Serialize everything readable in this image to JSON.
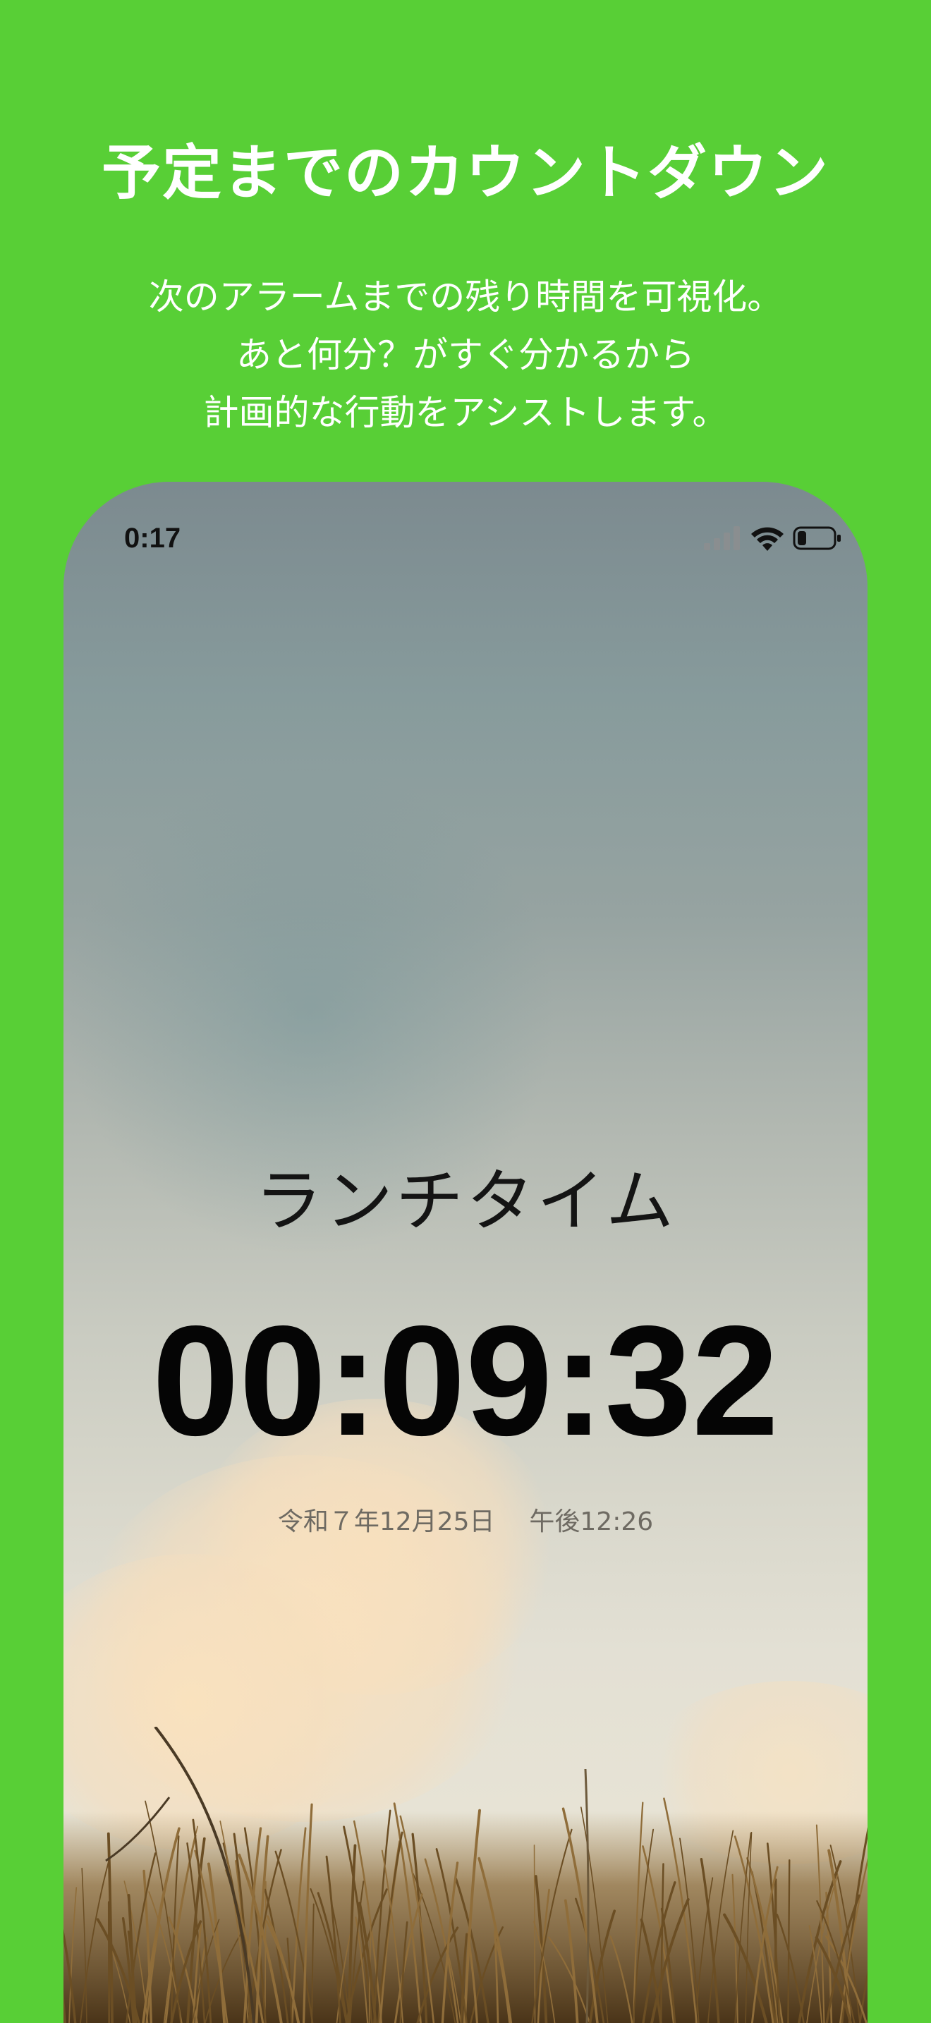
{
  "promo": {
    "title": "予定までのカウントダウン",
    "description_lines": [
      "次のアラームまでの残り時間を可視化。",
      "あと何分？がすぐ分かるから",
      "計画的な行動をアシストします。"
    ]
  },
  "status_bar": {
    "time": "0:17",
    "icons": [
      "signal-icon",
      "wifi-icon",
      "battery-icon"
    ]
  },
  "timer": {
    "event_title": "ランチタイム",
    "remaining": "00:09:32",
    "target_date": "令和７年12月25日",
    "target_time": "午後12:26"
  },
  "colors": {
    "background": "#58cf36",
    "promo_text": "#ffffff",
    "countdown_text": "#050505"
  }
}
